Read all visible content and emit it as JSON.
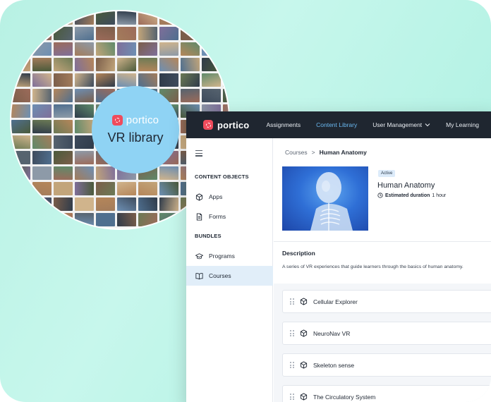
{
  "promo": {
    "logo_text": "portico",
    "title": "VR library"
  },
  "nav": {
    "logo_text": "portico",
    "items": [
      {
        "label": "Assignments",
        "active": false
      },
      {
        "label": "Content Library",
        "active": true
      },
      {
        "label": "User Management",
        "active": false,
        "has_dropdown": true
      },
      {
        "label": "My Learning",
        "active": false
      }
    ]
  },
  "sidebar": {
    "section_content": "CONTENT OBJECTS",
    "section_bundles": "BUNDLES",
    "items": [
      {
        "label": "Apps",
        "icon": "cube-icon"
      },
      {
        "label": "Forms",
        "icon": "document-icon"
      },
      {
        "label": "Programs",
        "icon": "graduation-cap-icon"
      },
      {
        "label": "Courses",
        "icon": "book-icon",
        "active": true
      }
    ]
  },
  "breadcrumb": {
    "parent": "Courses",
    "separator": ">",
    "current": "Human Anatomy"
  },
  "course": {
    "status": "Active",
    "title": "Human Anatomy",
    "duration_label": "Estimated duration",
    "duration_value": "1 hour",
    "description_heading": "Description",
    "description": "A series of VR experiences that guide learners through the basics of human anatomy."
  },
  "modules": [
    {
      "title": "Cellular Explorer"
    },
    {
      "title": "NeuroNav VR"
    },
    {
      "title": "Skeleton sense"
    },
    {
      "title": "The Circulatory System"
    }
  ],
  "colors": {
    "brand": "#ef4b5c",
    "nav_bg": "#1f2630",
    "nav_active": "#6ab8f0",
    "sidebar_active": "#e1eef9",
    "badge_bg": "#8fd3f4",
    "background_gradient": "#b8f1e4"
  }
}
